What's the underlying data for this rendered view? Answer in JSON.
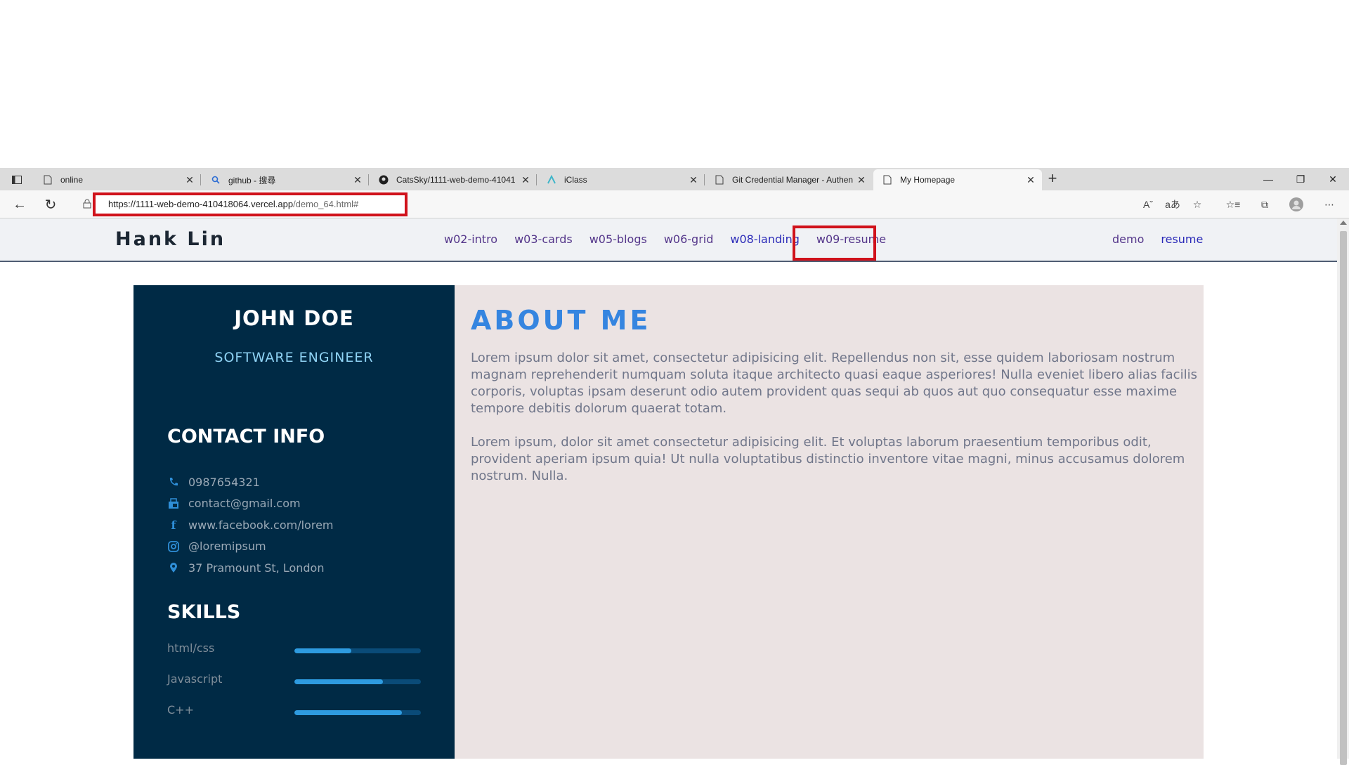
{
  "browser": {
    "tabs": [
      {
        "title": "online",
        "icon": "page-icon"
      },
      {
        "title": "github - 搜尋",
        "icon": "search-icon"
      },
      {
        "title": "CatsSky/1111-web-demo-41041",
        "icon": "github-icon"
      },
      {
        "title": "iClass",
        "icon": "iclass-icon"
      },
      {
        "title": "Git Credential Manager - Authen",
        "icon": "page-icon"
      },
      {
        "title": "My Homepage",
        "icon": "page-icon",
        "active": true
      }
    ],
    "url_host": "https://1111-web-demo-410418064.vercel.app",
    "url_path": "/demo_64.html#"
  },
  "site": {
    "brand": "Hank Lin",
    "nav": [
      "w02-intro",
      "w03-cards",
      "w05-blogs",
      "w06-grid",
      "w08-landing",
      "w09-resume"
    ],
    "nav_right": [
      "demo",
      "resume"
    ]
  },
  "resume": {
    "name": "JOHN DOE",
    "role": "SOFTWARE ENGINEER",
    "contact_title": "CONTACT INFO",
    "contacts": [
      {
        "icon": "phone-icon",
        "text": "0987654321"
      },
      {
        "icon": "fax-icon",
        "text": "contact@gmail.com"
      },
      {
        "icon": "facebook-icon",
        "text": "www.facebook.com/lorem"
      },
      {
        "icon": "instagram-icon",
        "text": "@loremipsum"
      },
      {
        "icon": "location-pin-icon",
        "text": "37 Pramount St, London"
      }
    ],
    "skills_title": "SKILLS",
    "skills": [
      {
        "label": "html/css",
        "level": 0.45
      },
      {
        "label": "Javascript",
        "level": 0.7
      },
      {
        "label": "C++",
        "level": 0.85
      }
    ],
    "about_title": "ABOUT ME",
    "about_p1": "Lorem ipsum dolor sit amet, consectetur adipisicing elit. Repellendus non sit, esse quidem laboriosam nostrum magnam reprehenderit numquam soluta itaque architecto quasi eaque asperiores! Nulla eveniet libero alias facilis corporis, voluptas ipsam deserunt odio autem provident quas sequi ab quos aut quo consequatur esse maxime tempore debitis dolorum quaerat totam.",
    "about_p2": "Lorem ipsum, dolor sit amet consectetur adipisicing elit. Et voluptas laborum praesentium temporibus odit, provident aperiam ipsum quia! Ut nulla voluptatibus distinctio inventore vitae magni, minus accusamus dolorem nostrum. Nulla."
  },
  "colors": {
    "highlight": "#d0121b",
    "sidebar": "#002a45",
    "accent": "#3585e0"
  }
}
